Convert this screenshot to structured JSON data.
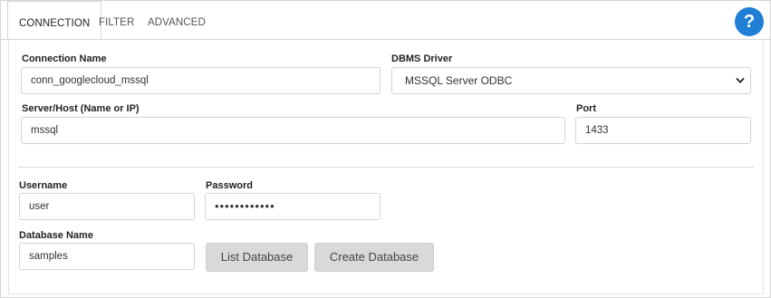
{
  "tabs": [
    {
      "label": "CONNECTION",
      "active": true
    },
    {
      "label": "FILTER",
      "active": false
    },
    {
      "label": "ADVANCED",
      "active": false
    }
  ],
  "help": {
    "label": "?",
    "icon": "help-icon",
    "color": "#1f7fd4"
  },
  "form": {
    "connection_name": {
      "label": "Connection Name",
      "value": "conn_googlecloud_mssql"
    },
    "dbms_driver": {
      "label": "DBMS Driver",
      "value": "MSSQL Server ODBC"
    },
    "server_host": {
      "label": "Server/Host (Name or IP)",
      "value": "mssql"
    },
    "port": {
      "label": "Port",
      "value": "1433"
    },
    "username": {
      "label": "Username",
      "value": "user"
    },
    "password": {
      "label": "Password",
      "value": "••••••••••••"
    },
    "database_name": {
      "label": "Database Name",
      "value": "samples"
    }
  },
  "buttons": {
    "list_database": "List Database",
    "create_database": "Create Database"
  }
}
